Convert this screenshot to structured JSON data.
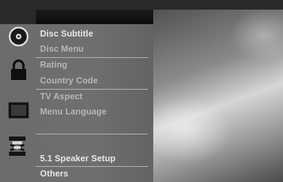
{
  "menu": {
    "groups": [
      {
        "icon": "disc-icon",
        "items": [
          "Disc Subtitle",
          "Disc Menu"
        ]
      },
      {
        "icon": "lock-icon",
        "items": [
          "Rating",
          "Country Code"
        ]
      },
      {
        "icon": "tv-screen-icon",
        "items": [
          "TV Aspect",
          "Menu Language"
        ]
      },
      {
        "icon": "speaker-icon",
        "items": [
          "5.1 Speaker Setup"
        ]
      },
      {
        "icon": null,
        "items": [
          "Others"
        ]
      }
    ]
  }
}
